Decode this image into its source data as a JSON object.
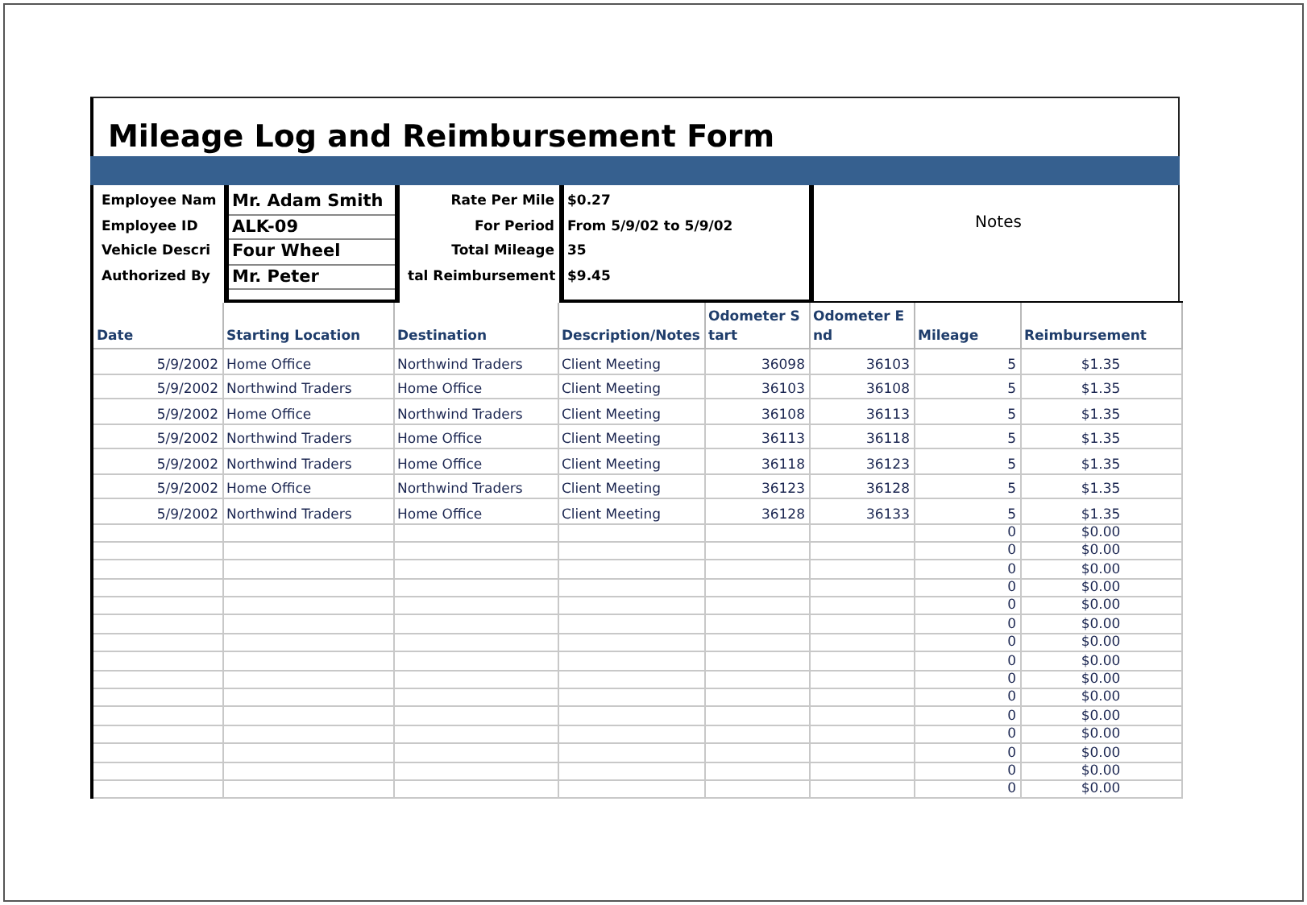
{
  "title": "Mileage Log and Reimbursement Form",
  "employee_info": [
    {
      "label": "Employee Nam",
      "value": "Mr. Adam Smith"
    },
    {
      "label": "Employee ID",
      "value": "ALK-09"
    },
    {
      "label": "Vehicle Descri",
      "value": "Four Wheel"
    },
    {
      "label": "Authorized By",
      "value": "Mr. Peter"
    }
  ],
  "summary": [
    {
      "label": "Rate Per Mile",
      "value": "$0.27"
    },
    {
      "label": "For Period",
      "value": "From 5/9/02 to 5/9/02"
    },
    {
      "label": "Total Mileage",
      "value": "35"
    },
    {
      "label": "tal Reimbursement",
      "value": "$9.45"
    }
  ],
  "notes_label": "Notes",
  "table": {
    "columns": [
      "Date",
      "Starting Location",
      "Destination",
      "Description/Notes",
      "Odometer Start",
      "Odometer End",
      "Mileage",
      "Reimbursement"
    ],
    "rows": [
      {
        "date": "5/9/2002",
        "start": "Home Office",
        "destination": "Northwind Traders",
        "description": "Client Meeting",
        "odometer_start": "36098",
        "odometer_end": "36103",
        "mileage": "5",
        "reimbursement": "$1.35"
      },
      {
        "date": "5/9/2002",
        "start": "Northwind Traders",
        "destination": "Home Office",
        "description": "Client Meeting",
        "odometer_start": "36103",
        "odometer_end": "36108",
        "mileage": "5",
        "reimbursement": "$1.35"
      },
      {
        "date": "5/9/2002",
        "start": "Home Office",
        "destination": "Northwind Traders",
        "description": "Client Meeting",
        "odometer_start": "36108",
        "odometer_end": "36113",
        "mileage": "5",
        "reimbursement": "$1.35"
      },
      {
        "date": "5/9/2002",
        "start": "Northwind Traders",
        "destination": "Home Office",
        "description": "Client Meeting",
        "odometer_start": "36113",
        "odometer_end": "36118",
        "mileage": "5",
        "reimbursement": "$1.35"
      },
      {
        "date": "5/9/2002",
        "start": "Northwind Traders",
        "destination": "Home Office",
        "description": "Client Meeting",
        "odometer_start": "36118",
        "odometer_end": "36123",
        "mileage": "5",
        "reimbursement": "$1.35"
      },
      {
        "date": "5/9/2002",
        "start": "Home Office",
        "destination": "Northwind Traders",
        "description": "Client Meeting",
        "odometer_start": "36123",
        "odometer_end": "36128",
        "mileage": "5",
        "reimbursement": "$1.35"
      },
      {
        "date": "5/9/2002",
        "start": "Northwind Traders",
        "destination": "Home Office",
        "description": "Client Meeting",
        "odometer_start": "36128",
        "odometer_end": "36133",
        "mileage": "5",
        "reimbursement": "$1.35"
      },
      {
        "mileage": "0",
        "reimbursement": "$0.00"
      },
      {
        "mileage": "0",
        "reimbursement": "$0.00"
      },
      {
        "mileage": "0",
        "reimbursement": "$0.00"
      },
      {
        "mileage": "0",
        "reimbursement": "$0.00"
      },
      {
        "mileage": "0",
        "reimbursement": "$0.00"
      },
      {
        "mileage": "0",
        "reimbursement": "$0.00"
      },
      {
        "mileage": "0",
        "reimbursement": "$0.00"
      },
      {
        "mileage": "0",
        "reimbursement": "$0.00"
      },
      {
        "mileage": "0",
        "reimbursement": "$0.00"
      },
      {
        "mileage": "0",
        "reimbursement": "$0.00"
      },
      {
        "mileage": "0",
        "reimbursement": "$0.00"
      },
      {
        "mileage": "0",
        "reimbursement": "$0.00"
      },
      {
        "mileage": "0",
        "reimbursement": "$0.00"
      },
      {
        "mileage": "0",
        "reimbursement": "$0.00"
      },
      {
        "mileage": "0",
        "reimbursement": "$0.00"
      }
    ]
  }
}
